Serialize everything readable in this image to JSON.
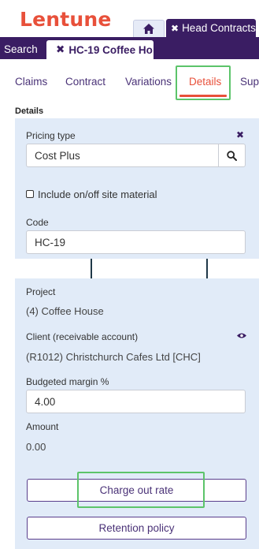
{
  "app": {
    "logo": "Lentune"
  },
  "top_tabs": {
    "head_contracts": "Head Contracts"
  },
  "bar": {
    "search": "Search",
    "doc_tab": "HC-19 Coffee Ho"
  },
  "nav": {
    "tabs": [
      {
        "label": "Claims"
      },
      {
        "label": "Contract"
      },
      {
        "label": "Variations"
      },
      {
        "label": "Details",
        "active": true
      },
      {
        "label": "Supp"
      }
    ]
  },
  "details": {
    "section_label": "Details",
    "pricing_type_label": "Pricing type",
    "pricing_type_value": "Cost Plus",
    "include_material_label": "Include on/off site material",
    "include_material_checked": false,
    "code_label": "Code",
    "code_value": "HC-19"
  },
  "project": {
    "project_label": "Project",
    "project_value": "(4) Coffee House",
    "client_label": "Client (receivable account)",
    "client_value": "(R1012) Christchurch Cafes Ltd [CHC]",
    "budgeted_margin_label": "Budgeted margin %",
    "budgeted_margin_value": "4.00",
    "amount_label": "Amount",
    "amount_value": "0.00"
  },
  "buttons": {
    "charge_out_rate": "Charge out rate",
    "retention_policy": "Retention policy"
  },
  "colors": {
    "brand_orange": "#e8503a",
    "brand_purple": "#3a1d63",
    "panel_bg": "#e1ebf8",
    "highlight_green": "#5cc46a"
  },
  "icons": [
    "home-icon",
    "close-icon",
    "search-icon",
    "eye-icon",
    "arrow-down-icon"
  ]
}
